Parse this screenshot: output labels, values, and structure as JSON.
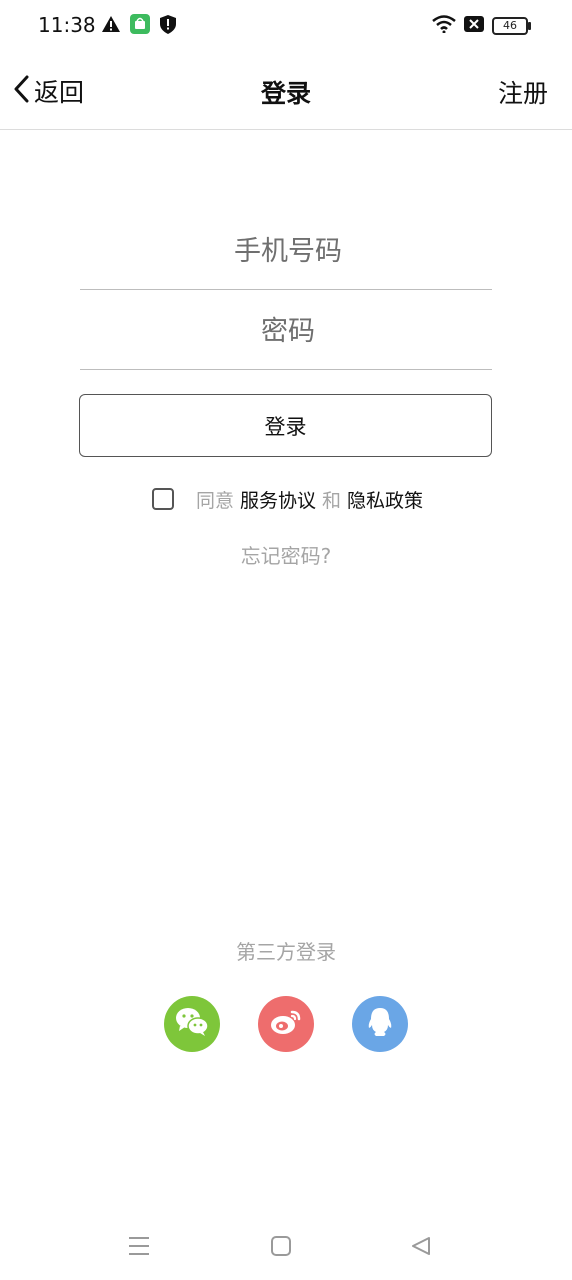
{
  "status_bar": {
    "time": "11:38",
    "battery": "46",
    "left_icons": [
      "warning-icon",
      "app-notification-icon",
      "shield-icon"
    ],
    "right_icons": [
      "wifi-icon",
      "no-sim-icon",
      "battery-icon"
    ]
  },
  "nav": {
    "back_label": "返回",
    "title": "登录",
    "register_label": "注册"
  },
  "form": {
    "phone_placeholder": "手机号码",
    "phone_value": "",
    "password_placeholder": "密码",
    "password_value": "",
    "login_button": "登录"
  },
  "agreement": {
    "checked": false,
    "agree_text": "同意",
    "service_link": "服务协议",
    "and_text": "和",
    "privacy_link": "隐私政策"
  },
  "forgot_password": "忘记密码?",
  "third_party": {
    "title": "第三方登录",
    "providers": [
      {
        "icon": "wechat-icon",
        "color": "#7ec63a"
      },
      {
        "icon": "weibo-icon",
        "color": "#ee6d6d"
      },
      {
        "icon": "qq-icon",
        "color": "#6aa6e6"
      }
    ]
  },
  "system_nav": [
    "menu-icon",
    "home-icon",
    "back-triangle-icon"
  ]
}
